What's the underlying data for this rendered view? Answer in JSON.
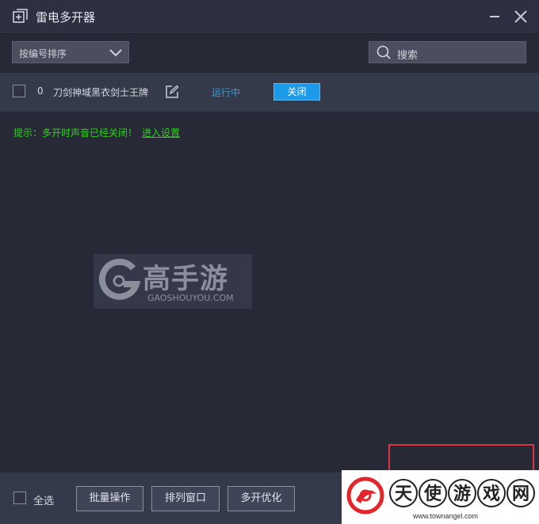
{
  "window": {
    "title": "雷电多开器",
    "icons": {
      "app": "add-window-icon",
      "minimize": "minimize-icon",
      "close": "close-icon"
    }
  },
  "toolbar": {
    "sort_label": "按编号排序",
    "sort_icon": "chevron-down-icon",
    "search_placeholder": "搜索",
    "search_icon": "search-icon"
  },
  "instances": [
    {
      "checked": false,
      "index": "0",
      "name": "刀剑神域黑衣剑士王牌",
      "edit_icon": "edit-icon",
      "status": "运行中",
      "action_label": "关闭"
    }
  ],
  "hint": {
    "text": "提示：多开时声音已经关闭！",
    "link": "进入设置"
  },
  "watermark": {
    "cn": "高手游",
    "en": "GAOSHOUYOU.COM"
  },
  "bottom_bar": {
    "select_all_label": "全选",
    "buttons": [
      "批量操作",
      "排列窗口",
      "多开优化"
    ]
  },
  "stamp": {
    "cn_chars": [
      "天",
      "使",
      "游",
      "戏",
      "网"
    ],
    "en": "www.townangel.com"
  },
  "colors": {
    "background": "#272a36",
    "row_background": "#353a4b",
    "accent_blue": "#1a9ae8",
    "status_blue": "#2c9fe0",
    "hint_green": "#2ed21a",
    "frame_red": "#d9363e"
  }
}
